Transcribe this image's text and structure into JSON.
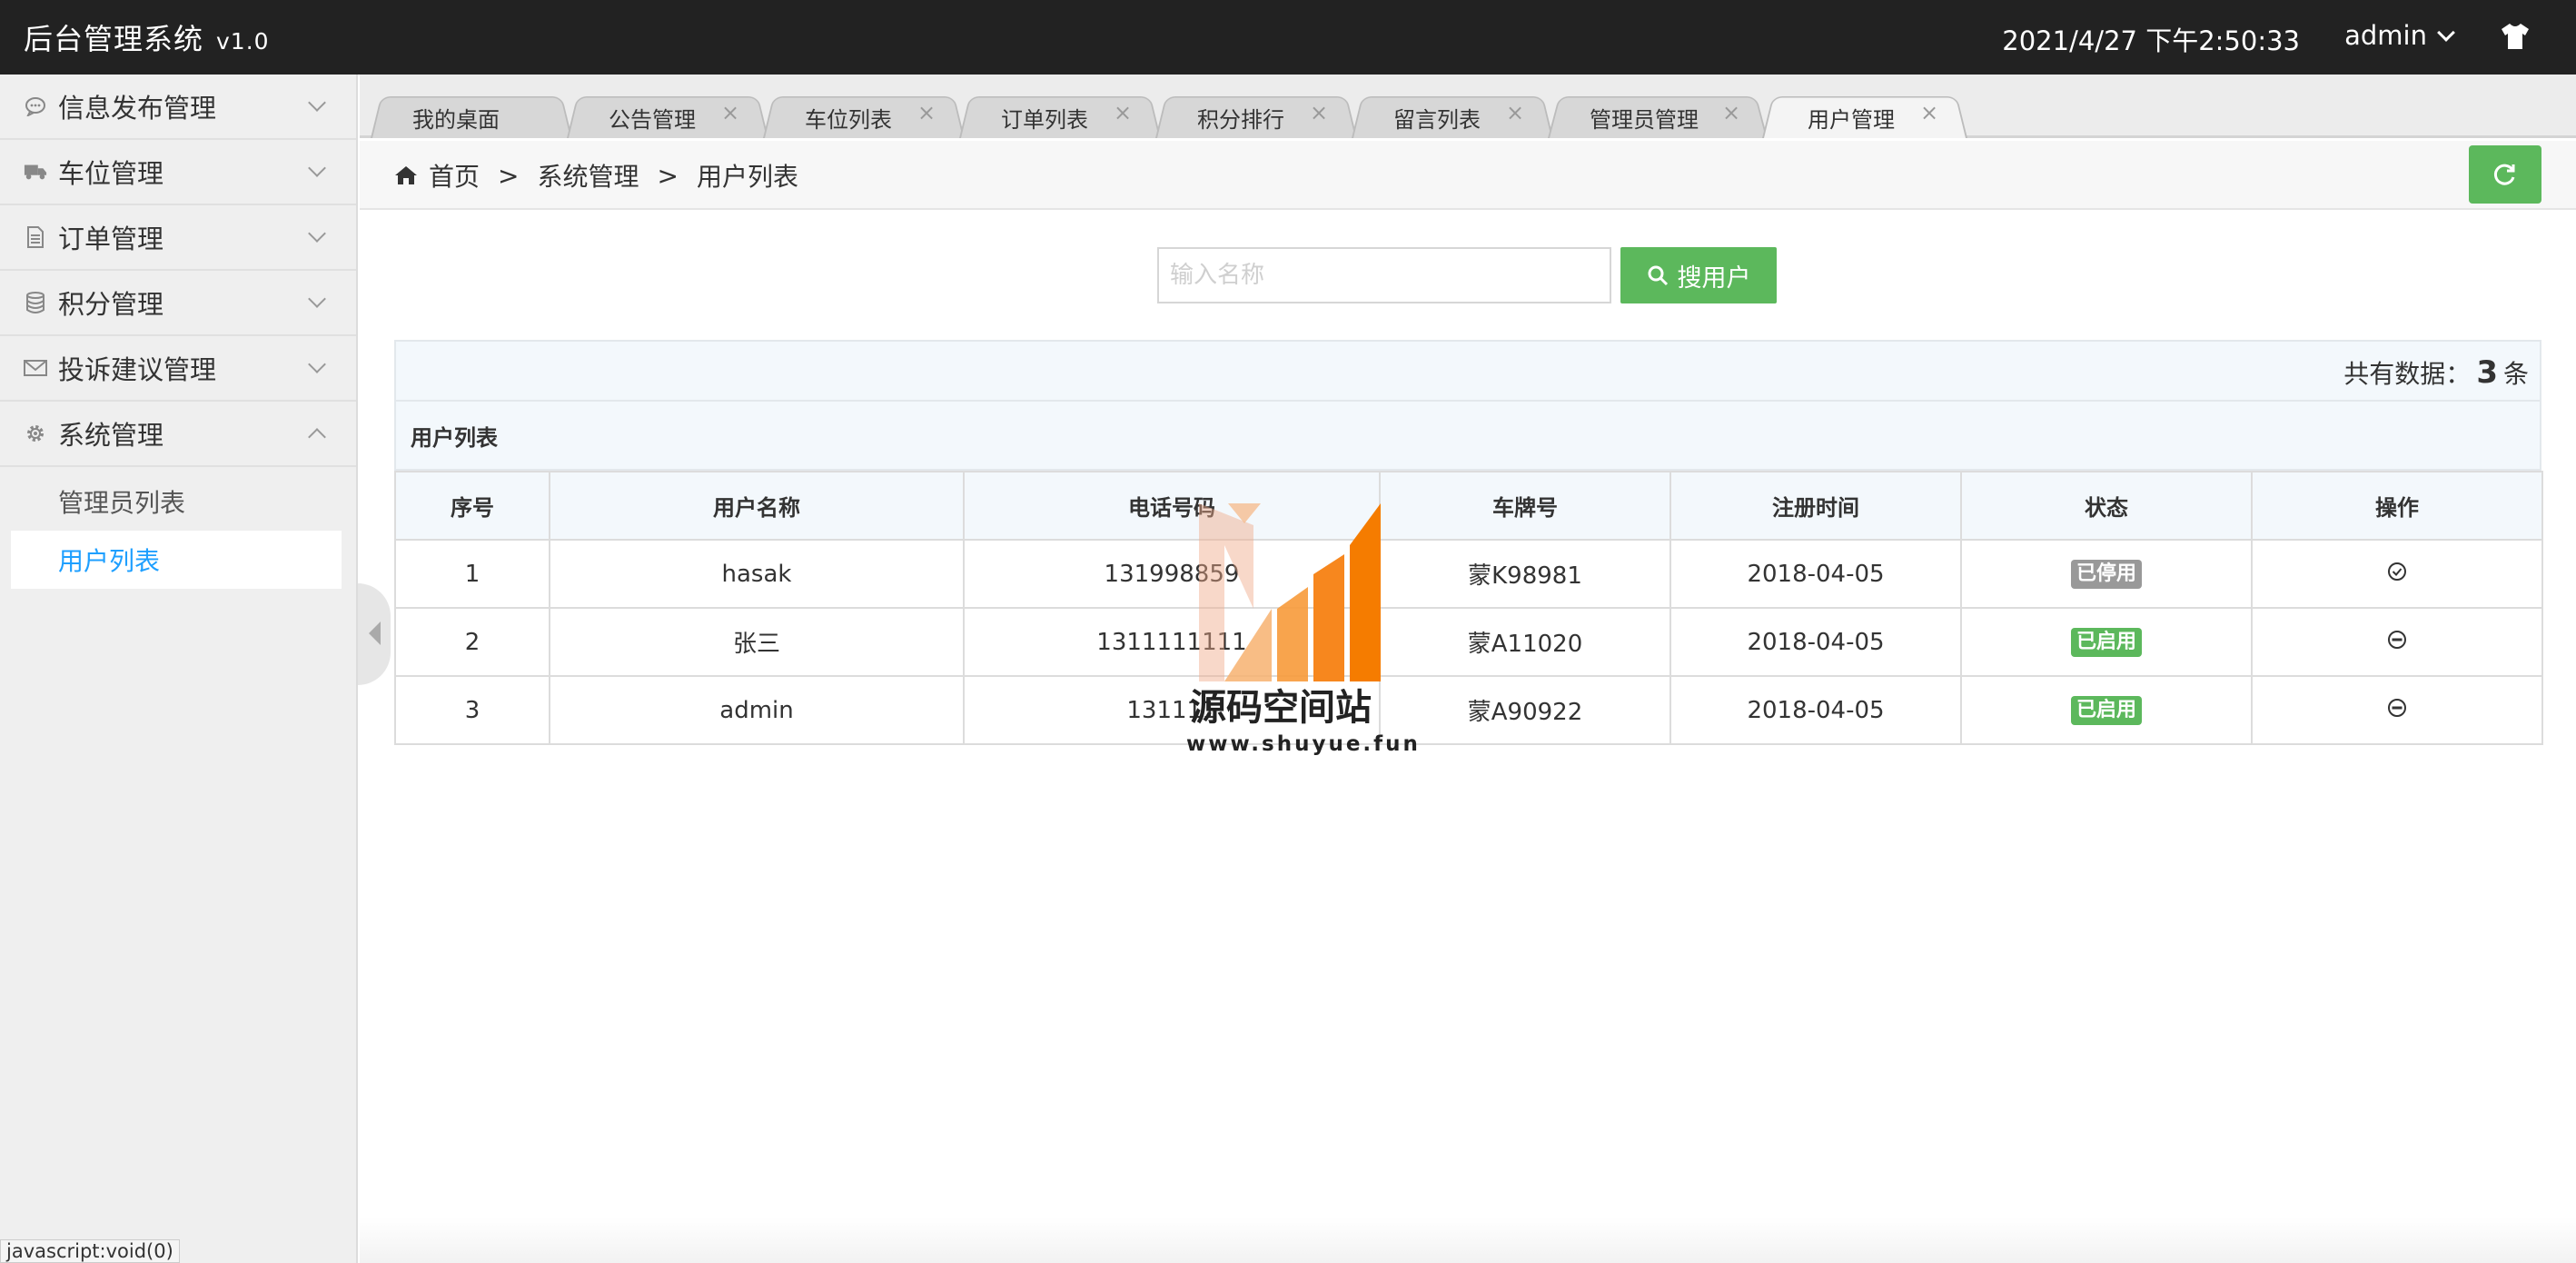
{
  "app": {
    "title": "后台管理系统",
    "version": "v1.0"
  },
  "header": {
    "datetime": "2021/4/27 下午2:50:33",
    "user": "admin"
  },
  "sidebar": {
    "items": [
      {
        "label": "信息发布管理",
        "icon": "message-icon"
      },
      {
        "label": "车位管理",
        "icon": "truck-icon"
      },
      {
        "label": "订单管理",
        "icon": "document-icon"
      },
      {
        "label": "积分管理",
        "icon": "database-icon"
      },
      {
        "label": "投诉建议管理",
        "icon": "envelope-icon"
      },
      {
        "label": "系统管理",
        "icon": "gear-icon",
        "expanded": true
      }
    ],
    "subitems": [
      {
        "label": "管理员列表"
      },
      {
        "label": "用户列表",
        "active": true
      }
    ]
  },
  "tabs": [
    {
      "label": "我的桌面"
    },
    {
      "label": "公告管理"
    },
    {
      "label": "车位列表"
    },
    {
      "label": "订单列表"
    },
    {
      "label": "积分排行"
    },
    {
      "label": "留言列表"
    },
    {
      "label": "管理员管理"
    },
    {
      "label": "用户管理",
      "active": true
    }
  ],
  "breadcrumb": {
    "home": "首页",
    "sep": ">",
    "level1": "系统管理",
    "level2": "用户列表"
  },
  "search": {
    "placeholder": "输入名称",
    "button": "搜用户"
  },
  "count": {
    "prefix": "共有数据：",
    "value": "3",
    "suffix": "条"
  },
  "table": {
    "title": "用户列表",
    "columns": [
      "序号",
      "用户名称",
      "电话号码",
      "车牌号",
      "注册时间",
      "状态",
      "操作"
    ],
    "rows": [
      {
        "id": "1",
        "name": "hasak",
        "phone": "131998859",
        "plate": "蒙K98981",
        "date": "2018-04-05",
        "status": "已停用",
        "status_type": "disabled",
        "action_icon": "check-circle-icon"
      },
      {
        "id": "2",
        "name": "张三",
        "phone": "1311111111",
        "plate": "蒙A11020",
        "date": "2018-04-05",
        "status": "已启用",
        "status_type": "enabled",
        "action_icon": "minus-circle-icon"
      },
      {
        "id": "3",
        "name": "admin",
        "phone": "131111",
        "plate": "蒙A90922",
        "date": "2018-04-05",
        "status": "已启用",
        "status_type": "enabled",
        "action_icon": "minus-circle-icon"
      }
    ]
  },
  "watermark": {
    "title": "源码空间站",
    "url": "www.shuyue.fun"
  },
  "statusbar": {
    "url": "javascript:void(0)"
  },
  "colors": {
    "header_bg": "#222222",
    "accent_green": "#5cb85c",
    "link_blue": "#1e9fff",
    "badge_gray": "#999999"
  }
}
